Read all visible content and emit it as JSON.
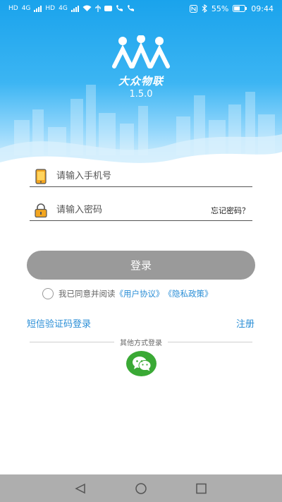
{
  "status_bar": {
    "left_labels": [
      "HD",
      "4G",
      "HD",
      "4G"
    ],
    "battery": "55%",
    "time": "09:44"
  },
  "brand": {
    "name": "大众物联",
    "version": "1.5.0"
  },
  "login_form": {
    "phone_placeholder": "请输入手机号",
    "password_placeholder": "请输入密码",
    "forgot_label": "忘记密码？",
    "login_label": "登录"
  },
  "agreement": {
    "prefix": "我已同意并阅读",
    "user_agreement": "《用户协议》",
    "privacy_policy": "《隐私政策》"
  },
  "links": {
    "sms_login": "短信验证码登录",
    "register": "注册"
  },
  "other_login": {
    "label": "其他方式登录",
    "icons": [
      "wechat-icon"
    ]
  },
  "colors": {
    "sky_top": "#1aa3ec",
    "link": "#2a8ed6",
    "login_button": "#9a9a9a",
    "wechat": "#3aa935"
  }
}
